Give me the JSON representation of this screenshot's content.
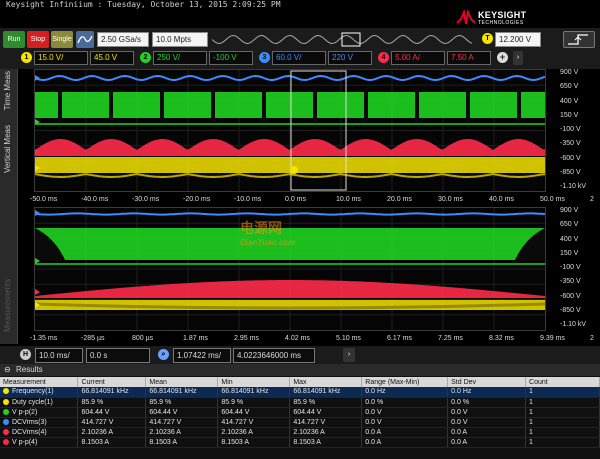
{
  "title_bar": "Keysight Infiniium : Tuesday, October 13, 2015 2:09:25 PM",
  "logo": {
    "brand": "KEYSIGHT",
    "sub": "TECHNOLOGIES"
  },
  "toolbar": {
    "run": "Run",
    "stop": "Stop",
    "single": "Single",
    "sample_rate": "2.50 GSa/s",
    "memory": "10.0 Mpts",
    "trigger_badge": "T",
    "trigger_level": "12.200 V"
  },
  "channels": [
    {
      "num": "1",
      "label_a": "15.0 V/",
      "label_b": "45.0 V",
      "color": "#f5e400"
    },
    {
      "num": "2",
      "label_a": "250 V/",
      "label_b": "-100 V",
      "color": "#1fd320"
    },
    {
      "num": "3",
      "label_a": "60.0 V/",
      "label_b": "220 V",
      "color": "#3a8cff"
    },
    {
      "num": "4",
      "label_a": "5.00 A/",
      "label_b": "7.50 A",
      "color": "#ff2a4a"
    }
  ],
  "side": {
    "time_meas": "Time Meas",
    "vertical_meas": "Vertical Meas",
    "measurements": "Measurements"
  },
  "upper_scale": [
    "900 V",
    "650 V",
    "400 V",
    "150 V",
    "-100 V",
    "-350 V",
    "-600 V",
    "-850 V",
    "-1.10 kV"
  ],
  "upper_time": [
    "-50.0 ms",
    "-40.0 ms",
    "-30.0 ms",
    "-20.0 ms",
    "-10.0 ms",
    "0.0 ms",
    "10.0 ms",
    "20.0 ms",
    "30.0 ms",
    "40.0 ms",
    "50.0 ms"
  ],
  "lower_scale": [
    "900 V",
    "650 V",
    "400 V",
    "150 V",
    "-100 V",
    "-350 V",
    "-600 V",
    "-850 V",
    "-1.10 kV"
  ],
  "lower_time": [
    "-1.35 ms",
    "-285 µs",
    "800 µs",
    "1.87 ms",
    "2.95 ms",
    "4.02 ms",
    "5.10 ms",
    "6.17 ms",
    "7.25 ms",
    "8.32 ms",
    "9.39 ms"
  ],
  "upper_right_num": "2",
  "lower_right_num": "2",
  "horizontal": {
    "badge": "H",
    "scale": "10.0 ms/",
    "delay": "0.0 s",
    "zoom_scale": "1.07422 ms/",
    "zoom_pos": "4.0223646000 ms"
  },
  "results": {
    "title": "Results",
    "headers": [
      "Measurement",
      "Current",
      "Mean",
      "Min",
      "Max",
      "Range (Max-Min)",
      "Std Dev",
      "Count"
    ],
    "rows": [
      {
        "name": "Frequency(1)",
        "color": "#f5e400",
        "current": "66.814091 kHz",
        "mean": "66.814091 kHz",
        "min": "66.814091 kHz",
        "max": "66.814091 kHz",
        "range": "0.0 Hz",
        "std": "0.0 Hz",
        "count": "1"
      },
      {
        "name": "Duty cycle(1)",
        "color": "#f5e400",
        "current": "85.9 %",
        "mean": "85.9 %",
        "min": "85.9 %",
        "max": "85.9 %",
        "range": "0.0 %",
        "std": "0.0 %",
        "count": "1"
      },
      {
        "name": "V p-p(2)",
        "color": "#1fd320",
        "current": "604.44 V",
        "mean": "604.44 V",
        "min": "604.44 V",
        "max": "604.44 V",
        "range": "0.0 V",
        "std": "0.0 V",
        "count": "1"
      },
      {
        "name": "DCVrms(3)",
        "color": "#3a8cff",
        "current": "414.727 V",
        "mean": "414.727 V",
        "min": "414.727 V",
        "max": "414.727 V",
        "range": "0.0 V",
        "std": "0.0 V",
        "count": "1"
      },
      {
        "name": "DCVrms(4)",
        "color": "#ff2a4a",
        "current": "2.10236 A",
        "mean": "2.10236 A",
        "min": "2.10236 A",
        "max": "2.10236 A",
        "range": "0.0 A",
        "std": "0.0 A",
        "count": "1"
      },
      {
        "name": "V p-p(4)",
        "color": "#ff2a4a",
        "current": "8.1503 A",
        "mean": "8.1503 A",
        "min": "8.1503 A",
        "max": "8.1503 A",
        "range": "0.0 A",
        "std": "0.0 A",
        "count": "1"
      }
    ]
  },
  "watermark": {
    "main": "电源网",
    "sub": "DianYuan.com"
  }
}
